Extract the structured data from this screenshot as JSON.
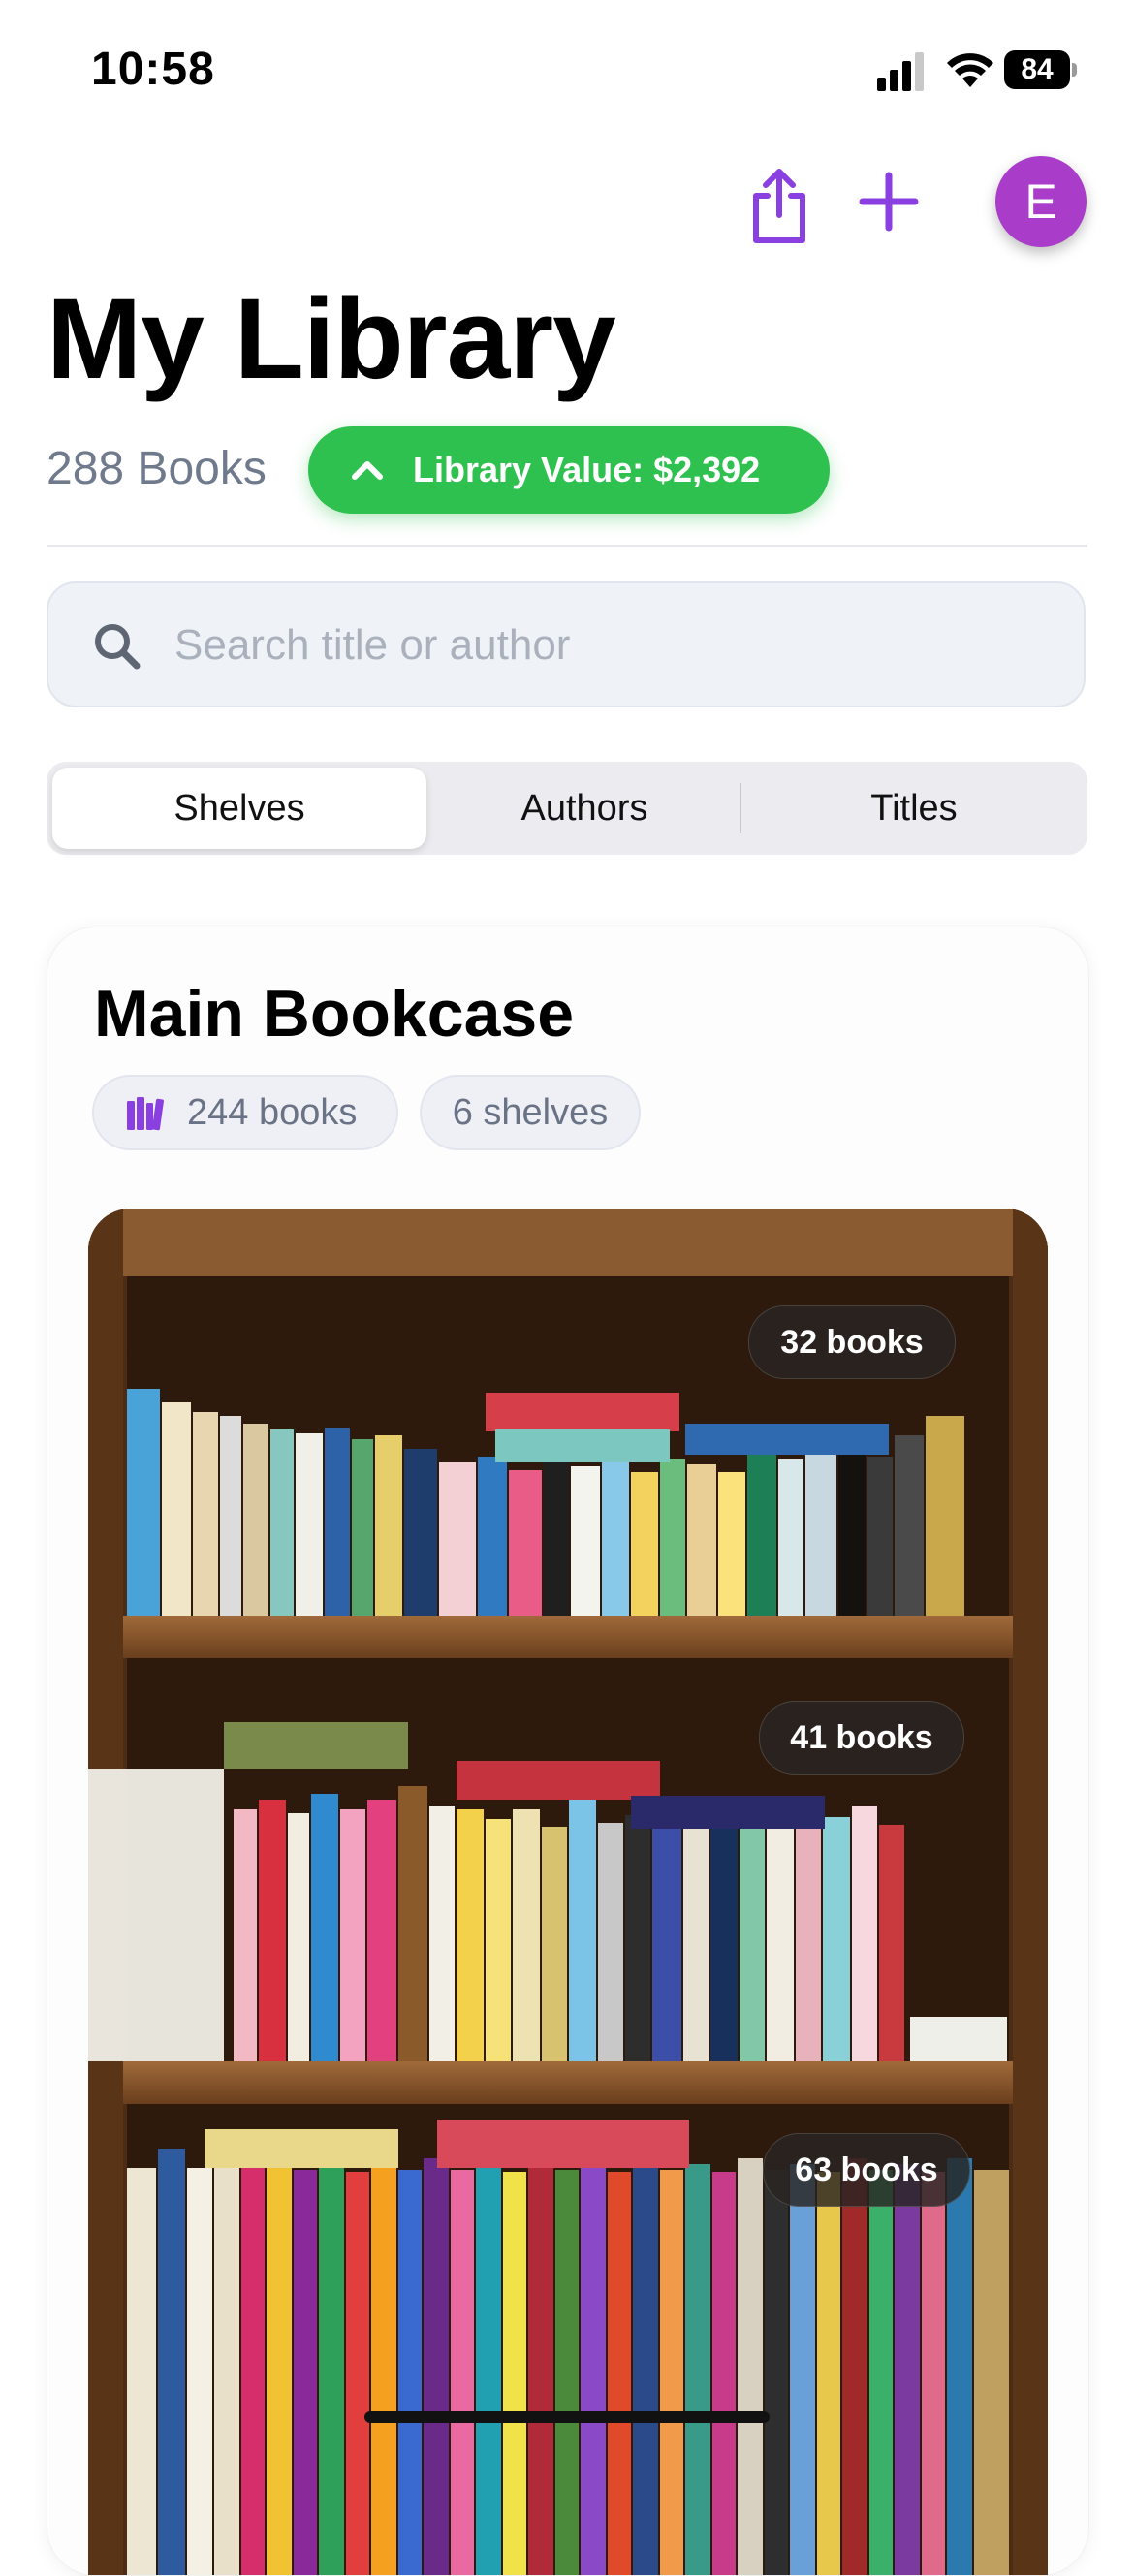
{
  "status_bar": {
    "time": "10:58",
    "battery": "84"
  },
  "header": {
    "avatar_initial": "E",
    "title": "My Library",
    "book_count": "288 Books",
    "library_value": "Library Value: $2,392"
  },
  "search": {
    "placeholder": "Search title or author",
    "value": ""
  },
  "tabs": [
    {
      "label": "Shelves",
      "selected": true
    },
    {
      "label": "Authors",
      "selected": false
    },
    {
      "label": "Titles",
      "selected": false
    }
  ],
  "bookcase": {
    "name": "Main Bookcase",
    "books_chip": "244 books",
    "shelves_chip": "6 shelves",
    "shelf_counts": [
      "32 books",
      "41 books",
      "63 books"
    ]
  },
  "colors": {
    "accent": "#8a3fe0",
    "value_green": "#2fc14f",
    "avatar": "#a93cc9"
  },
  "icons": [
    "share-icon",
    "plus-icon",
    "chevron-up-icon",
    "search-icon",
    "books-icon"
  ]
}
